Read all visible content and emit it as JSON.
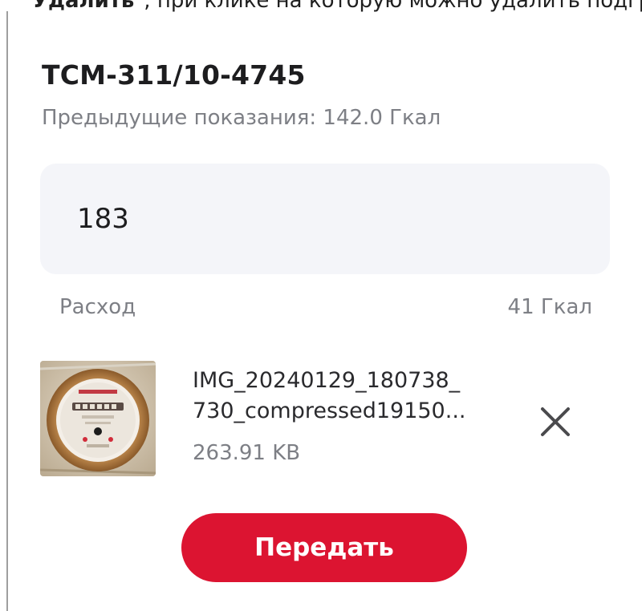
{
  "top_fragment": {
    "bold": "Удалить",
    "rest": "\", при клике на которую можно удалить подгр"
  },
  "meter": {
    "serial": "ТСМ-311/10-4745",
    "previous_reading_label": "Предыдущие показания: 142.0 Гкал"
  },
  "reading_input": {
    "value": "183",
    "placeholder": ""
  },
  "usage": {
    "label": "Расход",
    "value": "41 Гкал"
  },
  "attachment": {
    "name_line1": "IMG_20240129_180738_",
    "name_line2": "730_compressed19150...",
    "size": "263.91 KB",
    "thumbnail_icon": "meter-photo-thumbnail",
    "remove_icon": "close-icon"
  },
  "submit_button": {
    "label": "Передать"
  },
  "colors": {
    "accent": "#dc1431",
    "input_bg": "#f4f5f9",
    "muted_text": "#7d7f85",
    "primary_text": "#1d1d1f"
  }
}
